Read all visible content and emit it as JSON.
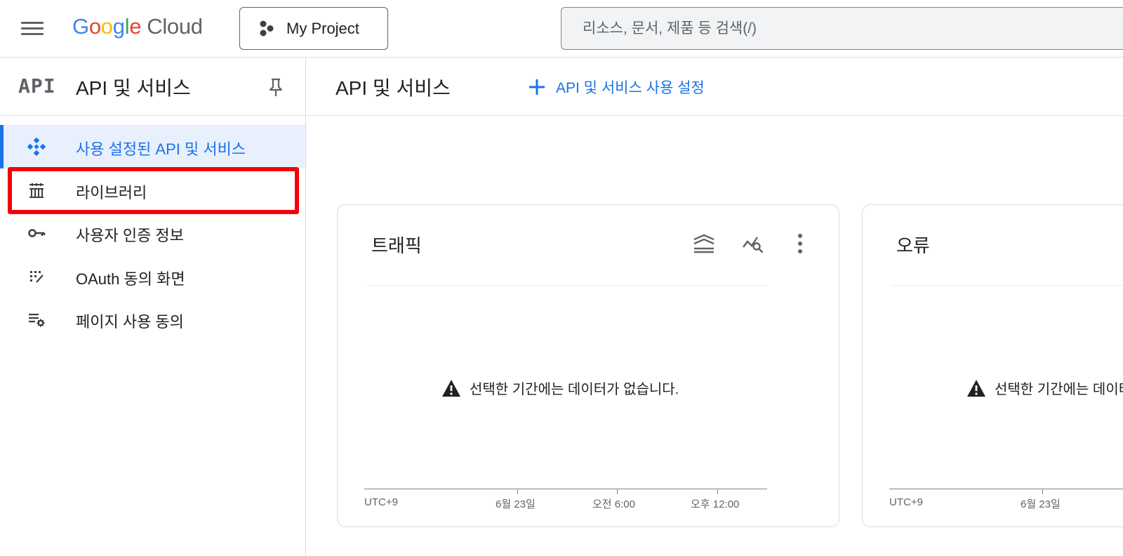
{
  "topbar": {
    "logo": {
      "g1": "G",
      "g2": "o",
      "g3": "o",
      "g4": "g",
      "g5": "l",
      "g6": "e",
      "cloud": "Cloud"
    },
    "project_label": "My Project",
    "search_placeholder": "리소스, 문서, 제품 등 검색(/)"
  },
  "sidebar": {
    "logo_text": "API",
    "title": "API 및 서비스",
    "items": [
      {
        "label": "사용 설정된 API 및 서비스",
        "icon": "diamond-dots-icon",
        "active": true
      },
      {
        "label": "라이브러리",
        "icon": "library-icon",
        "active": false
      },
      {
        "label": "사용자 인증 정보",
        "icon": "key-icon",
        "active": false
      },
      {
        "label": "OAuth 동의 화면",
        "icon": "oauth-icon",
        "active": false
      },
      {
        "label": "페이지 사용 동의",
        "icon": "settings-list-icon",
        "active": false
      }
    ]
  },
  "main": {
    "title": "API 및 서비스",
    "enable_button": "API 및 서비스 사용 설정",
    "cards": [
      {
        "title": "트래픽",
        "empty_message": "선택한 기간에는 데이터가 없습니다.",
        "axis_labels": [
          "UTC+9",
          "6월 23일",
          "오전 6:00",
          "오후 12:00"
        ]
      },
      {
        "title": "오류",
        "empty_message": "선택한 기간에는 데이터가 없습니다.",
        "axis_labels": [
          "UTC+9",
          "6월 23일"
        ]
      }
    ]
  },
  "colors": {
    "accent": "#1a73e8",
    "highlight": "#f60008",
    "active_bg": "#e8f0fe"
  }
}
